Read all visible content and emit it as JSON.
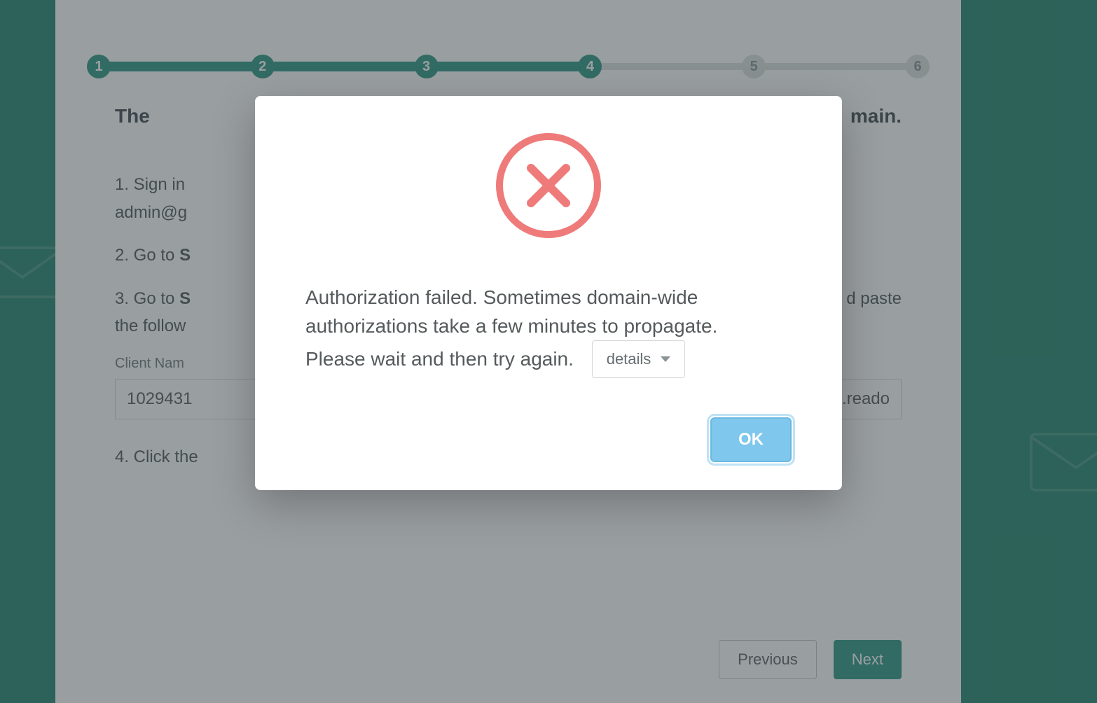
{
  "stepper": {
    "total": 6,
    "current": 4,
    "labels": [
      "1",
      "2",
      "3",
      "4",
      "5",
      "6"
    ]
  },
  "page": {
    "headline_prefix": "The",
    "headline_suffix": "main.",
    "step1_prefix": "1. Sign in",
    "step1_cont": "admin@g",
    "step2_prefix": "2. Go to ",
    "step2_bold": "S",
    "step3_prefix": "3. Go to ",
    "step3_bold": "S",
    "step3_suffix": "d paste",
    "step3_cont": "the follow",
    "client_name_label": "Client Nam",
    "client_name_value": "1029431",
    "scope_value_suffix": "in.reado",
    "step4_prefix": "4. Click the"
  },
  "wizard": {
    "previous": "Previous",
    "next": "Next"
  },
  "modal": {
    "message_line1": "Authorization failed. Sometimes domain-wide",
    "message_line2": "authorizations take a few minutes to propagate.",
    "message_line3": "Please wait and then try again.",
    "details_label": "details",
    "ok_label": "OK"
  }
}
